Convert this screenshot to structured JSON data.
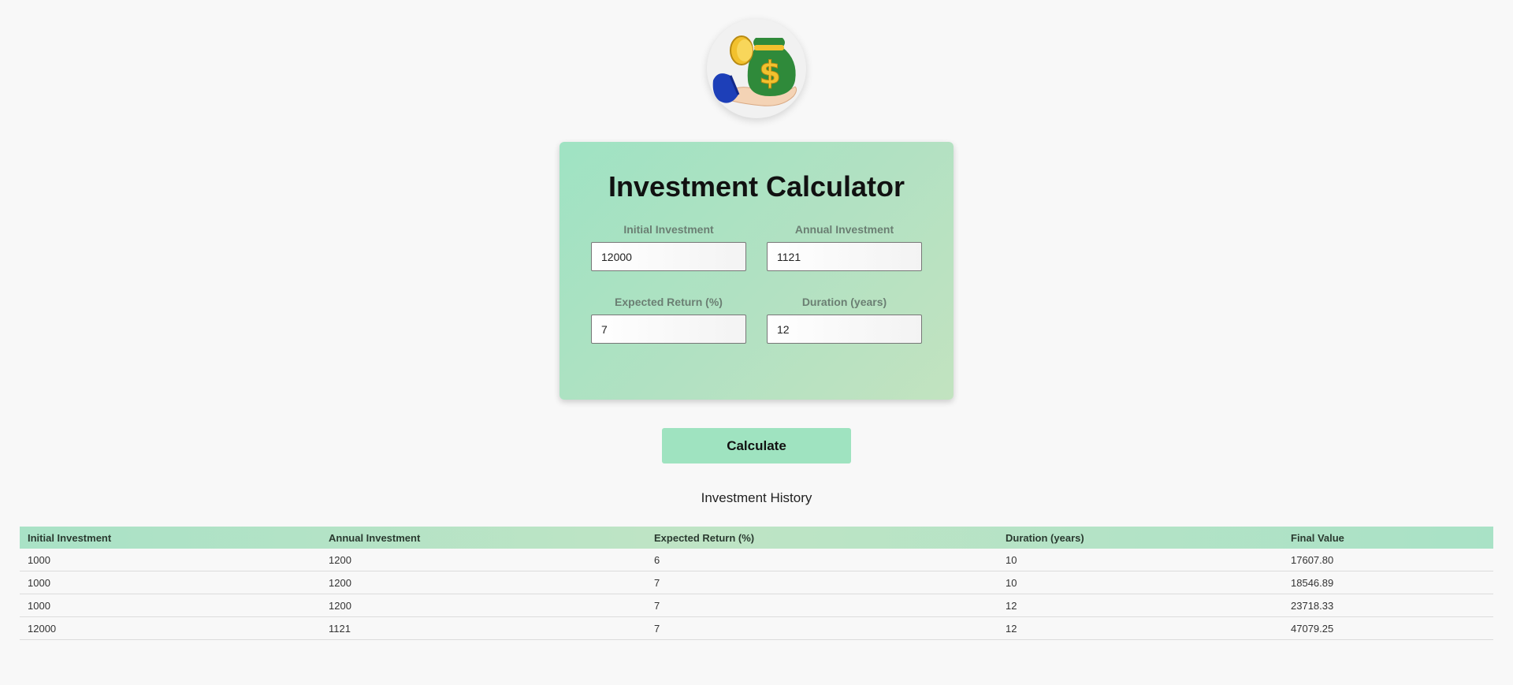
{
  "app": {
    "title": "Investment Calculator",
    "logo_icon": "money-bag-in-hand-icon"
  },
  "form": {
    "initial_investment": {
      "label": "Initial Investment",
      "value": "12000"
    },
    "annual_investment": {
      "label": "Annual Investment",
      "value": "1121"
    },
    "expected_return": {
      "label": "Expected Return (%)",
      "value": "7"
    },
    "duration": {
      "label": "Duration (years)",
      "value": "12"
    }
  },
  "actions": {
    "calculate_label": "Calculate"
  },
  "history": {
    "title": "Investment History",
    "columns": [
      "Initial Investment",
      "Annual Investment",
      "Expected Return (%)",
      "Duration (years)",
      "Final Value"
    ],
    "rows": [
      [
        "1000",
        "1200",
        "6",
        "10",
        "17607.80"
      ],
      [
        "1000",
        "1200",
        "7",
        "10",
        "18546.89"
      ],
      [
        "1000",
        "1200",
        "7",
        "12",
        "23718.33"
      ],
      [
        "12000",
        "1121",
        "7",
        "12",
        "47079.25"
      ]
    ]
  },
  "colors": {
    "accent": "#9fe3c0",
    "background": "#f8f8f8",
    "bag_green": "#2f8a3a",
    "coin_gold": "#f2c12e",
    "sleeve_blue": "#1d3fb8"
  }
}
